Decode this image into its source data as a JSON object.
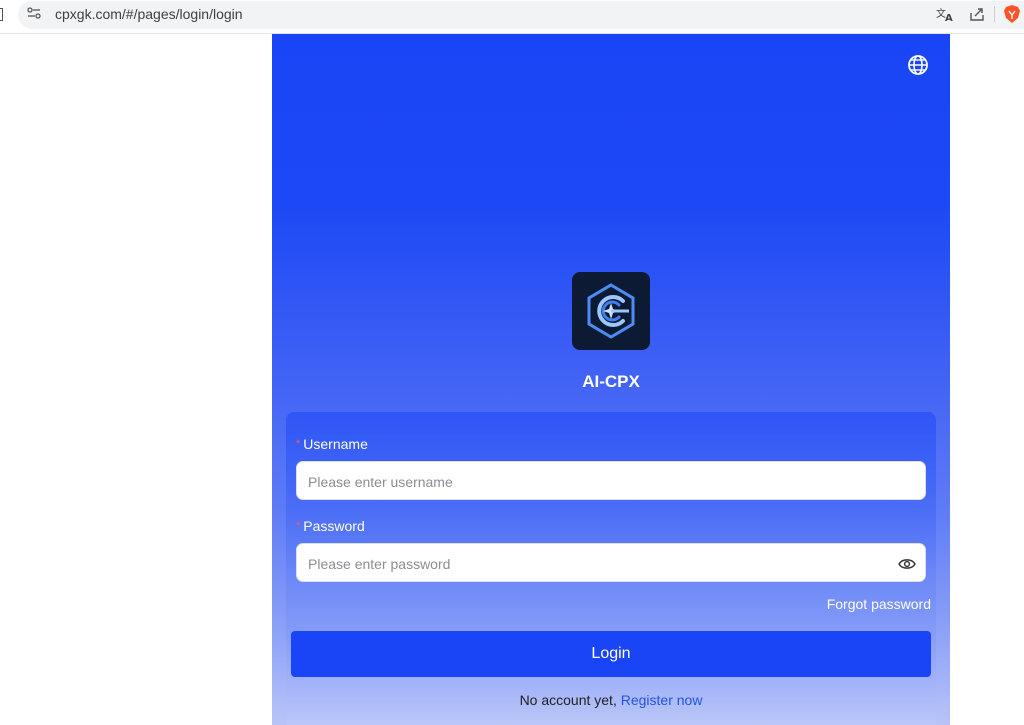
{
  "browser": {
    "url": "cpxgk.com/#/pages/login/login"
  },
  "app": {
    "title": "AI-CPX",
    "logo_name": "ai-cpx-logo",
    "colors": {
      "primary": "#1a45f6",
      "link": "#2352e8",
      "required": "#ff5a5a"
    }
  },
  "form": {
    "required_mark": "*",
    "username_label": "Username",
    "username_placeholder": "Please enter username",
    "username_value": "",
    "password_label": "Password",
    "password_placeholder": "Please enter password",
    "password_value": "",
    "forgot_label": "Forgot password",
    "login_label": "Login",
    "no_account_text": "No account yet, ",
    "register_label": "Register now"
  },
  "icons": [
    "site-info-icon",
    "translate-icon",
    "share-icon",
    "brave-icon",
    "globe-icon",
    "eye-icon"
  ]
}
